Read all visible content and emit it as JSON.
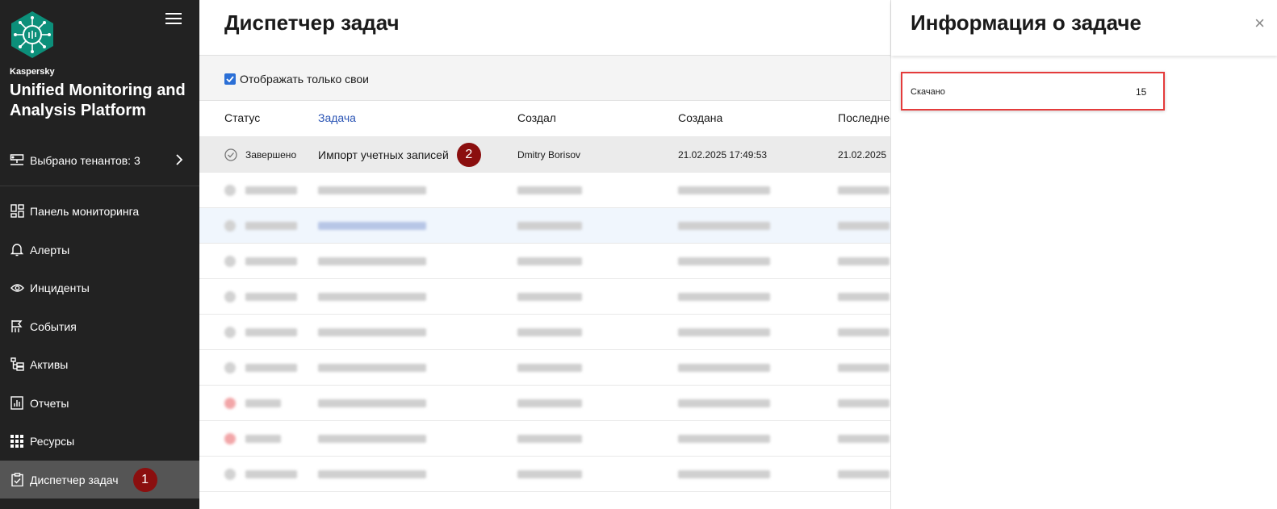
{
  "sidebar": {
    "brand_small": "Kaspersky",
    "brand_title": "Unified Monitoring and Analysis Platform",
    "tenants_label": "Выбрано тенантов: 3",
    "items": [
      {
        "label": "Панель мониторинга",
        "icon": "dashboard-icon"
      },
      {
        "label": "Алерты",
        "icon": "bell-icon"
      },
      {
        "label": "Инциденты",
        "icon": "eye-icon"
      },
      {
        "label": "События",
        "icon": "flag-icon"
      },
      {
        "label": "Активы",
        "icon": "assets-tree-icon"
      },
      {
        "label": "Отчеты",
        "icon": "chart-report-icon"
      },
      {
        "label": "Ресурсы",
        "icon": "grid-icon"
      },
      {
        "label": "Диспетчер задач",
        "icon": "clipboard-check-icon",
        "active": true,
        "badge": "1"
      }
    ]
  },
  "main": {
    "title": "Диспетчер задач",
    "filter_label": "Отображать только свои",
    "filter_checked": true,
    "columns": [
      "Статус",
      "Задача",
      "Создал",
      "Создана",
      "Последнее"
    ],
    "first_row": {
      "status": "Завершено",
      "task": "Импорт учетных записей",
      "task_badge": "2",
      "creator": "Dmitry Borisov",
      "created": "21.02.2025 17:49:53",
      "last": "21.02.2025"
    }
  },
  "panel": {
    "title": "Информация о задаче",
    "close": "×",
    "info_label": "Скачано",
    "info_value": "15"
  },
  "colors": {
    "sidebar_bg": "#222222",
    "active_item_bg": "#555555",
    "badge": "#8b0f0f",
    "link": "#2b55b5",
    "highlight_border": "#e43b3b",
    "checkbox": "#2b6fd6"
  }
}
